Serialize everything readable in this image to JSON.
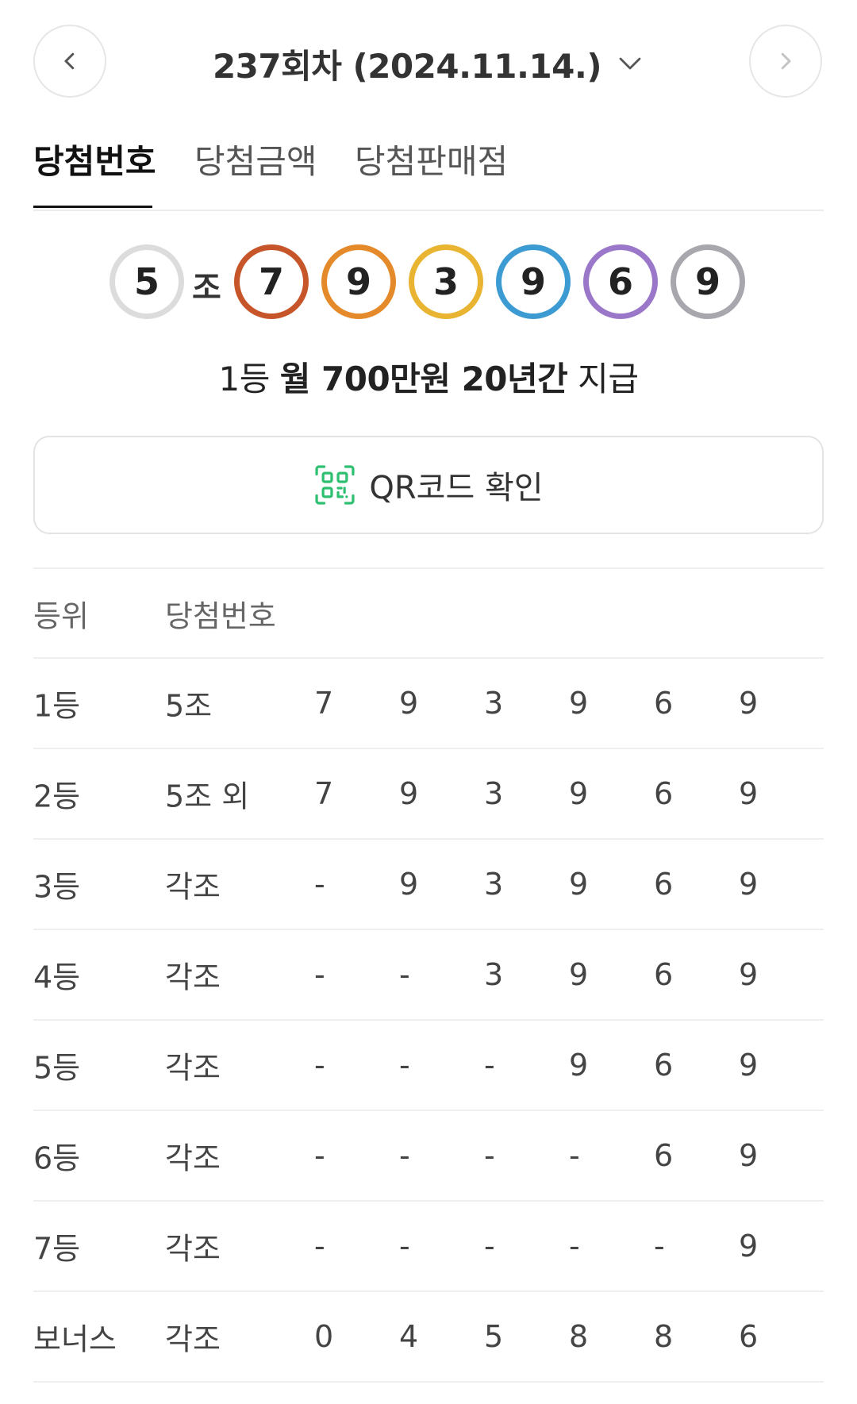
{
  "header": {
    "round_title": "237회차 (2024.11.14.)"
  },
  "tabs": [
    {
      "label": "당첨번호",
      "active": true
    },
    {
      "label": "당첨금액",
      "active": false
    },
    {
      "label": "당첨판매점",
      "active": false
    }
  ],
  "winning": {
    "group": "5",
    "jo_label": "조",
    "balls": [
      {
        "number": "7",
        "color": "#c7552a"
      },
      {
        "number": "9",
        "color": "#e58a2a"
      },
      {
        "number": "3",
        "color": "#e8b431"
      },
      {
        "number": "9",
        "color": "#3b9bd2"
      },
      {
        "number": "6",
        "color": "#9a77c9"
      },
      {
        "number": "9",
        "color": "#a7a7ad"
      }
    ],
    "group_color": "#dcdcdc"
  },
  "prize": {
    "prefix": "1등 ",
    "amount": "월 700만원 20년간",
    "suffix": " 지급"
  },
  "qr": {
    "label": "QR코드 확인",
    "icon": "qr-code-icon",
    "icon_color": "#2fbf71"
  },
  "table": {
    "header": {
      "rank": "등위",
      "numbers": "당첨번호"
    },
    "rows": [
      {
        "rank": "1등",
        "group": "5조",
        "digits": [
          "7",
          "9",
          "3",
          "9",
          "6",
          "9"
        ]
      },
      {
        "rank": "2등",
        "group": "5조 외",
        "digits": [
          "7",
          "9",
          "3",
          "9",
          "6",
          "9"
        ]
      },
      {
        "rank": "3등",
        "group": "각조",
        "digits": [
          "-",
          "9",
          "3",
          "9",
          "6",
          "9"
        ]
      },
      {
        "rank": "4등",
        "group": "각조",
        "digits": [
          "-",
          "-",
          "3",
          "9",
          "6",
          "9"
        ]
      },
      {
        "rank": "5등",
        "group": "각조",
        "digits": [
          "-",
          "-",
          "-",
          "9",
          "6",
          "9"
        ]
      },
      {
        "rank": "6등",
        "group": "각조",
        "digits": [
          "-",
          "-",
          "-",
          "-",
          "6",
          "9"
        ]
      },
      {
        "rank": "7등",
        "group": "각조",
        "digits": [
          "-",
          "-",
          "-",
          "-",
          "-",
          "9"
        ]
      },
      {
        "rank": "보너스",
        "group": "각조",
        "digits": [
          "0",
          "4",
          "5",
          "8",
          "8",
          "6"
        ]
      }
    ]
  }
}
